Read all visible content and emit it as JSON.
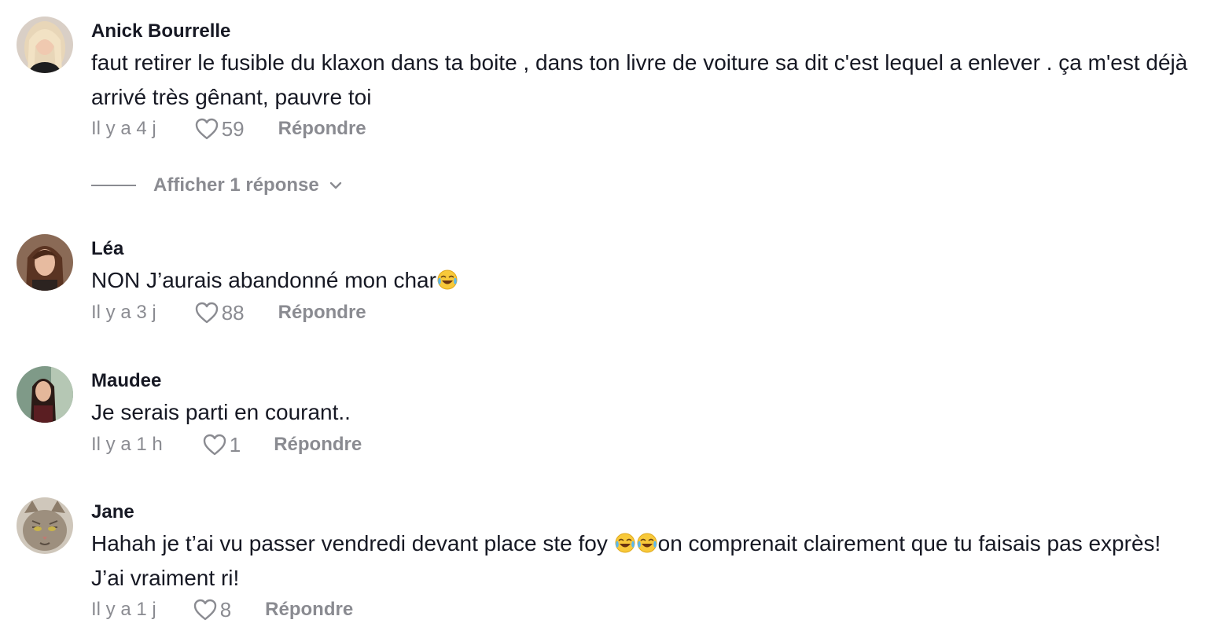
{
  "comments": [
    {
      "author": "Anick Bourrelle",
      "avatar_icon": "avatar-blonde-woman",
      "text_parts": [
        "faut retirer le fusible du klaxon dans ta boite , dans ton livre de voiture sa dit c'est lequel a enlever . ça m'est déjà arrivé très gênant, pauvre toi"
      ],
      "time": "Il y a 4 j",
      "likes": "59",
      "reply_label": "Répondre",
      "view_replies": "Afficher 1 réponse"
    },
    {
      "author": "Léa",
      "avatar_icon": "avatar-brunette-woman",
      "text_parts": [
        "NON J’aurais abandonné mon char"
      ],
      "emoji": "face-with-tears-of-joy",
      "time": "Il y a 3 j",
      "likes": "88",
      "reply_label": "Répondre"
    },
    {
      "author": "Maudee",
      "avatar_icon": "avatar-dark-hair-woman",
      "text_parts": [
        "Je serais parti en courant.."
      ],
      "time": "Il y a 1 h",
      "likes": "1",
      "reply_label": "Répondre"
    },
    {
      "author": "Jane",
      "avatar_icon": "avatar-cat",
      "text_parts": [
        "Hahah je t’ai vu passer vendredi devant place ste foy ",
        "on comprenait clairement que tu faisais pas exprès! J’ai vraiment ri!"
      ],
      "emoji": "face-with-tears-of-joy",
      "time": "Il y a 1 j",
      "likes": "8",
      "reply_label": "Répondre"
    }
  ],
  "colors": {
    "text": "#161823",
    "muted": "#8a8b91",
    "background": "#ffffff"
  }
}
